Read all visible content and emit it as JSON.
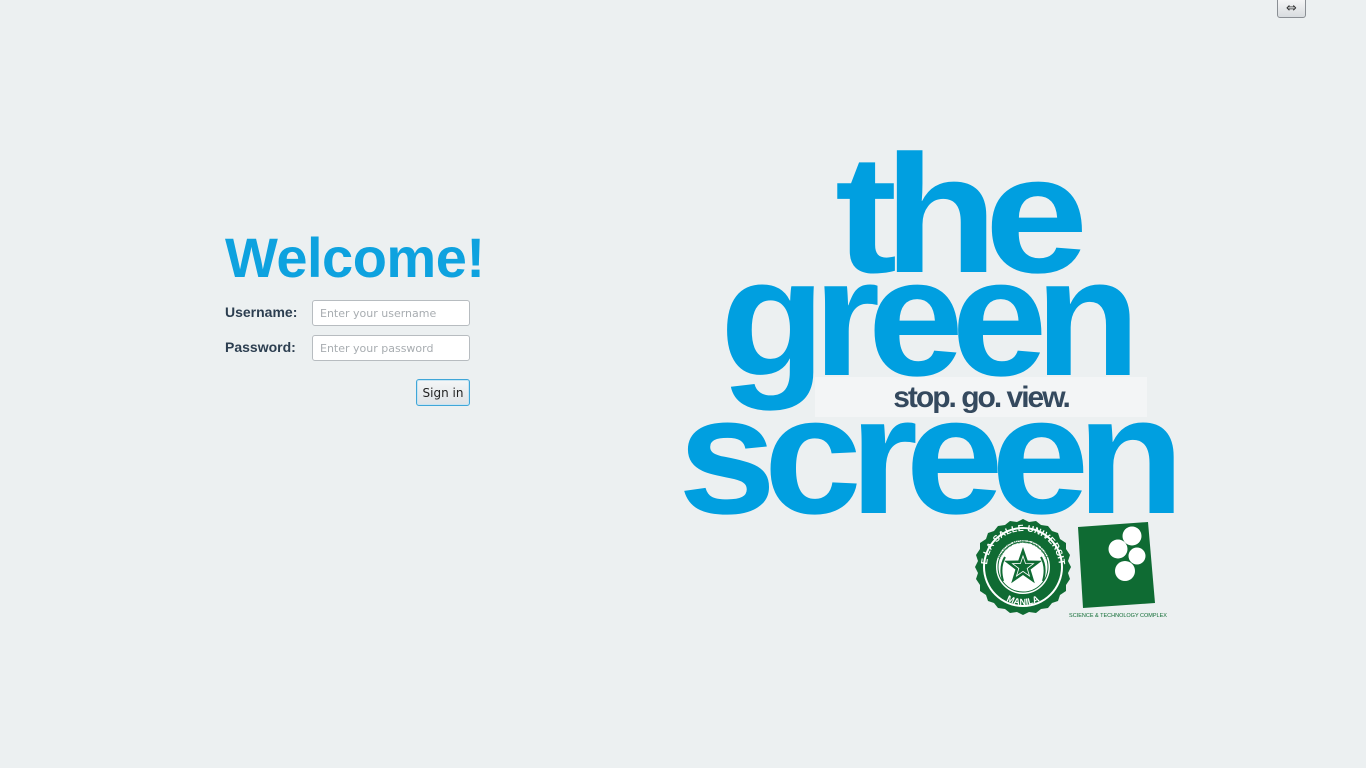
{
  "topbar": {
    "resize_glyph": "⇔"
  },
  "login": {
    "heading": "Welcome!",
    "username_label": "Username:",
    "username_placeholder": "Enter your username",
    "username_value": "",
    "password_label": "Password:",
    "password_placeholder": "Enter your password",
    "password_value": "",
    "signin_label": "Sign in"
  },
  "brand": {
    "line1": "the",
    "line2": "green",
    "tagline": "stop. go. view.",
    "line3": "screen",
    "seal_top_text": "DE LA SALLE UNIVERSITY",
    "seal_inner_text": "RELIGIO MORES CULTURA",
    "seal_bottom_text": "MANILA",
    "stc_caption": "SCIENCE & TECHNOLOGY COMPLEX"
  },
  "colors": {
    "accent": "#0ea2df",
    "logo_blue": "#009fe0",
    "dlsu_green": "#0f6b33",
    "background": "#ecf0f1",
    "label_text": "#2c3e50"
  }
}
